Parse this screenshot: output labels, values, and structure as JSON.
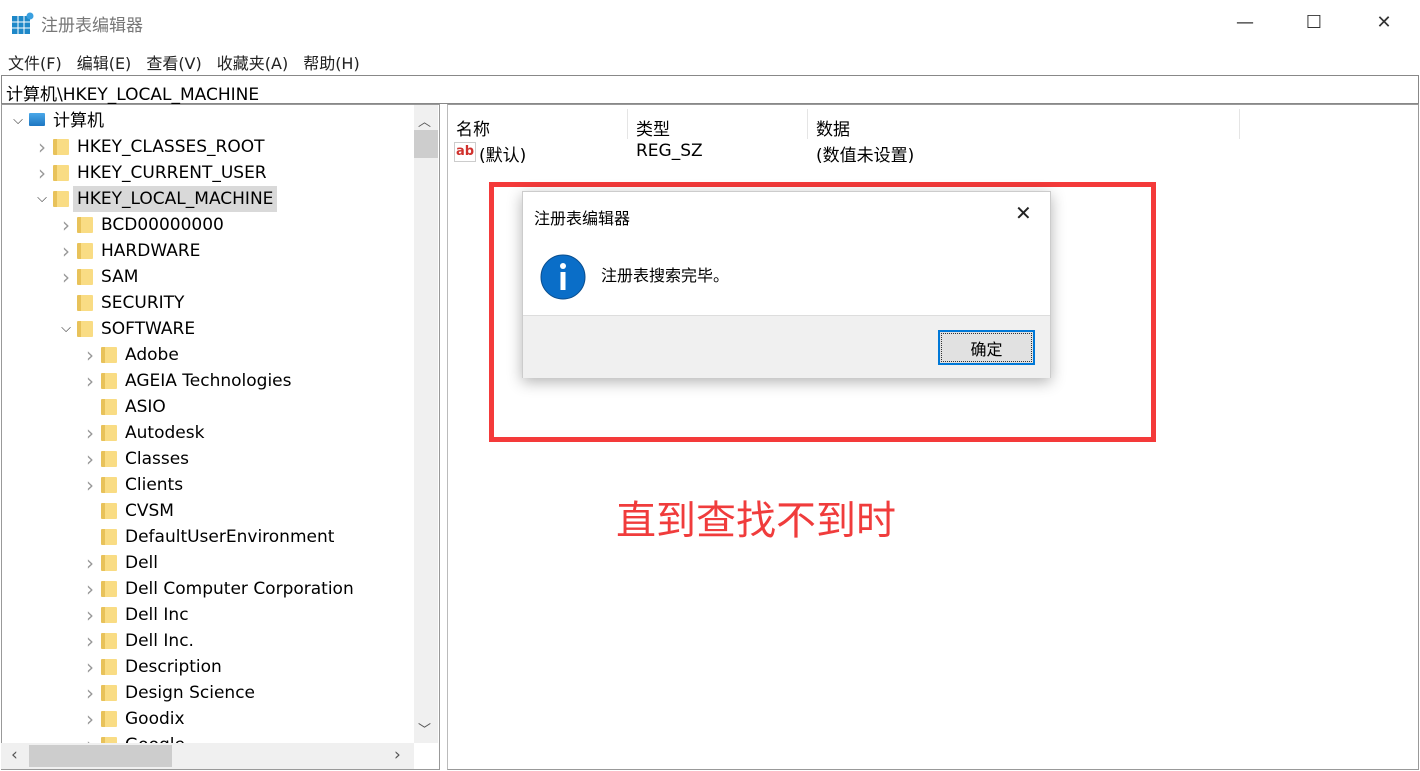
{
  "window": {
    "title": "注册表编辑器",
    "icon": "registry-editor-icon",
    "minimize": "—",
    "maximize": "☐",
    "close": "✕"
  },
  "menu": [
    "文件(F)",
    "编辑(E)",
    "查看(V)",
    "收藏夹(A)",
    "帮助(H)"
  ],
  "address": "计算机\\HKEY_LOCAL_MACHINE",
  "tree": [
    {
      "label": "计算机",
      "level": 0,
      "arrow": "open",
      "icon": "computer"
    },
    {
      "label": "HKEY_CLASSES_ROOT",
      "level": 1,
      "arrow": "closed"
    },
    {
      "label": "HKEY_CURRENT_USER",
      "level": 1,
      "arrow": "closed"
    },
    {
      "label": "HKEY_LOCAL_MACHINE",
      "level": 1,
      "arrow": "open",
      "selected": true
    },
    {
      "label": "BCD00000000",
      "level": 2,
      "arrow": "closed"
    },
    {
      "label": "HARDWARE",
      "level": 2,
      "arrow": "closed"
    },
    {
      "label": "SAM",
      "level": 2,
      "arrow": "closed"
    },
    {
      "label": "SECURITY",
      "level": 2,
      "arrow": "none"
    },
    {
      "label": "SOFTWARE",
      "level": 2,
      "arrow": "open"
    },
    {
      "label": "Adobe",
      "level": 3,
      "arrow": "closed"
    },
    {
      "label": "AGEIA Technologies",
      "level": 3,
      "arrow": "closed"
    },
    {
      "label": "ASIO",
      "level": 3,
      "arrow": "none"
    },
    {
      "label": "Autodesk",
      "level": 3,
      "arrow": "closed"
    },
    {
      "label": "Classes",
      "level": 3,
      "arrow": "closed"
    },
    {
      "label": "Clients",
      "level": 3,
      "arrow": "closed"
    },
    {
      "label": "CVSM",
      "level": 3,
      "arrow": "none"
    },
    {
      "label": "DefaultUserEnvironment",
      "level": 3,
      "arrow": "none"
    },
    {
      "label": "Dell",
      "level": 3,
      "arrow": "closed"
    },
    {
      "label": "Dell Computer Corporation",
      "level": 3,
      "arrow": "closed"
    },
    {
      "label": "Dell Inc",
      "level": 3,
      "arrow": "closed"
    },
    {
      "label": "Dell Inc.",
      "level": 3,
      "arrow": "closed"
    },
    {
      "label": "Description",
      "level": 3,
      "arrow": "closed"
    },
    {
      "label": "Design Science",
      "level": 3,
      "arrow": "closed"
    },
    {
      "label": "Goodix",
      "level": 3,
      "arrow": "closed"
    },
    {
      "label": "Google",
      "level": 3,
      "arrow": "closed"
    }
  ],
  "list": {
    "columns": [
      "名称",
      "类型",
      "数据"
    ],
    "rows": [
      {
        "name": "(默认)",
        "type": "REG_SZ",
        "data": "(数值未设置)",
        "icon": "string-value-icon"
      }
    ]
  },
  "dialog": {
    "title": "注册表编辑器",
    "message": "注册表搜索完毕。",
    "ok": "确定",
    "icon": "info-icon"
  },
  "annotation": {
    "text": "直到查找不到时",
    "color": "#f03c3c"
  }
}
